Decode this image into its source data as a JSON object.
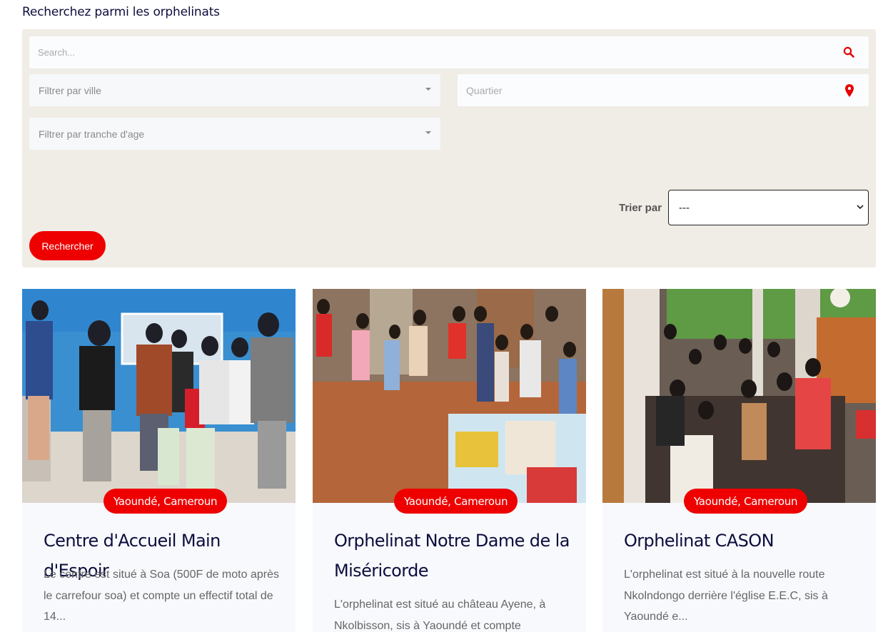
{
  "page": {
    "heading": "Recherchez parmi les orphelinats"
  },
  "filters": {
    "search_placeholder": "Search...",
    "city_placeholder": "Filtrer par ville",
    "district_placeholder": "Quartier",
    "age_placeholder": "Filtrer par tranche d'age",
    "sort_label": "Trier par",
    "sort_value": "---",
    "submit_label": "Rechercher"
  },
  "cards": [
    {
      "location": "Yaoundé, Cameroun",
      "title": "Centre d'Accueil Main d'Espoir",
      "description": "Le centre est situé à Soa (500F de moto après le carrefour soa) et compte un effectif total de 14..."
    },
    {
      "location": "Yaoundé, Cameroun",
      "title": "Orphelinat Notre Dame de la Miséricorde",
      "description": "L'orphelinat est situé au château Ayene, à Nkolbisson, sis à Yaoundé et compte"
    },
    {
      "location": "Yaoundé, Cameroun",
      "title": "Orphelinat CASON",
      "description": "L'orphelinat est situé à la nouvelle route Nkolndongo derrière l'église E.E.C, sis à Yaoundé e..."
    }
  ],
  "colors": {
    "accent": "#ee0000",
    "panel": "#f0ece6",
    "title": "#0d0d3d"
  }
}
